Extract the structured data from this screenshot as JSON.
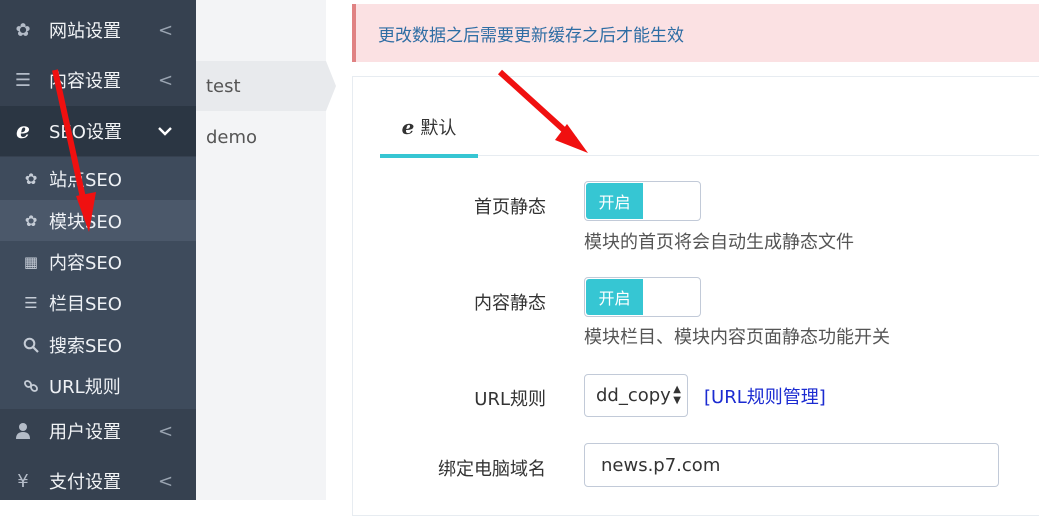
{
  "sidebar": {
    "menu": [
      {
        "label": "网站设置",
        "icon": "gear-icon",
        "chevron": "<"
      },
      {
        "label": "内容设置",
        "icon": "list-icon",
        "chevron": "<"
      },
      {
        "label": "SEO设置",
        "icon": "ie-icon",
        "chevron": "⌄"
      },
      {
        "label": "用户设置",
        "icon": "user-icon",
        "chevron": "<"
      },
      {
        "label": "支付设置",
        "icon": "yen-icon",
        "chevron": "<"
      }
    ],
    "seo_submenu": [
      {
        "label": "站点SEO",
        "icon": "gear-icon"
      },
      {
        "label": "模块SEO",
        "icon": "gears-icon"
      },
      {
        "label": "内容SEO",
        "icon": "grid-icon"
      },
      {
        "label": "栏目SEO",
        "icon": "list-icon"
      },
      {
        "label": "搜索SEO",
        "icon": "search-icon"
      },
      {
        "label": "URL规则",
        "icon": "link-icon"
      }
    ]
  },
  "sites": [
    {
      "label": "test"
    },
    {
      "label": "demo"
    }
  ],
  "alert": {
    "text": "更改数据之后需要更新缓存之后才能生效"
  },
  "tabs": [
    {
      "label": "默认",
      "icon": "ie-icon"
    }
  ],
  "form": {
    "home_static": {
      "label": "首页静态",
      "toggle": "开启",
      "help": "模块的首页将会自动生成静态文件"
    },
    "content_static": {
      "label": "内容静态",
      "toggle": "开启",
      "help": "模块栏目、模块内容页面静态功能开关"
    },
    "url_rule": {
      "label": "URL规则",
      "value": "dd_copy",
      "manage_link": "[URL规则管理]"
    },
    "pc_domain": {
      "label": "绑定电脑域名",
      "value": "news.p7.com"
    }
  },
  "colors": {
    "sidebar": "#364150",
    "accent": "#36c6d3",
    "arrow": "#f01010",
    "alert_bg": "#fbe1e3"
  }
}
